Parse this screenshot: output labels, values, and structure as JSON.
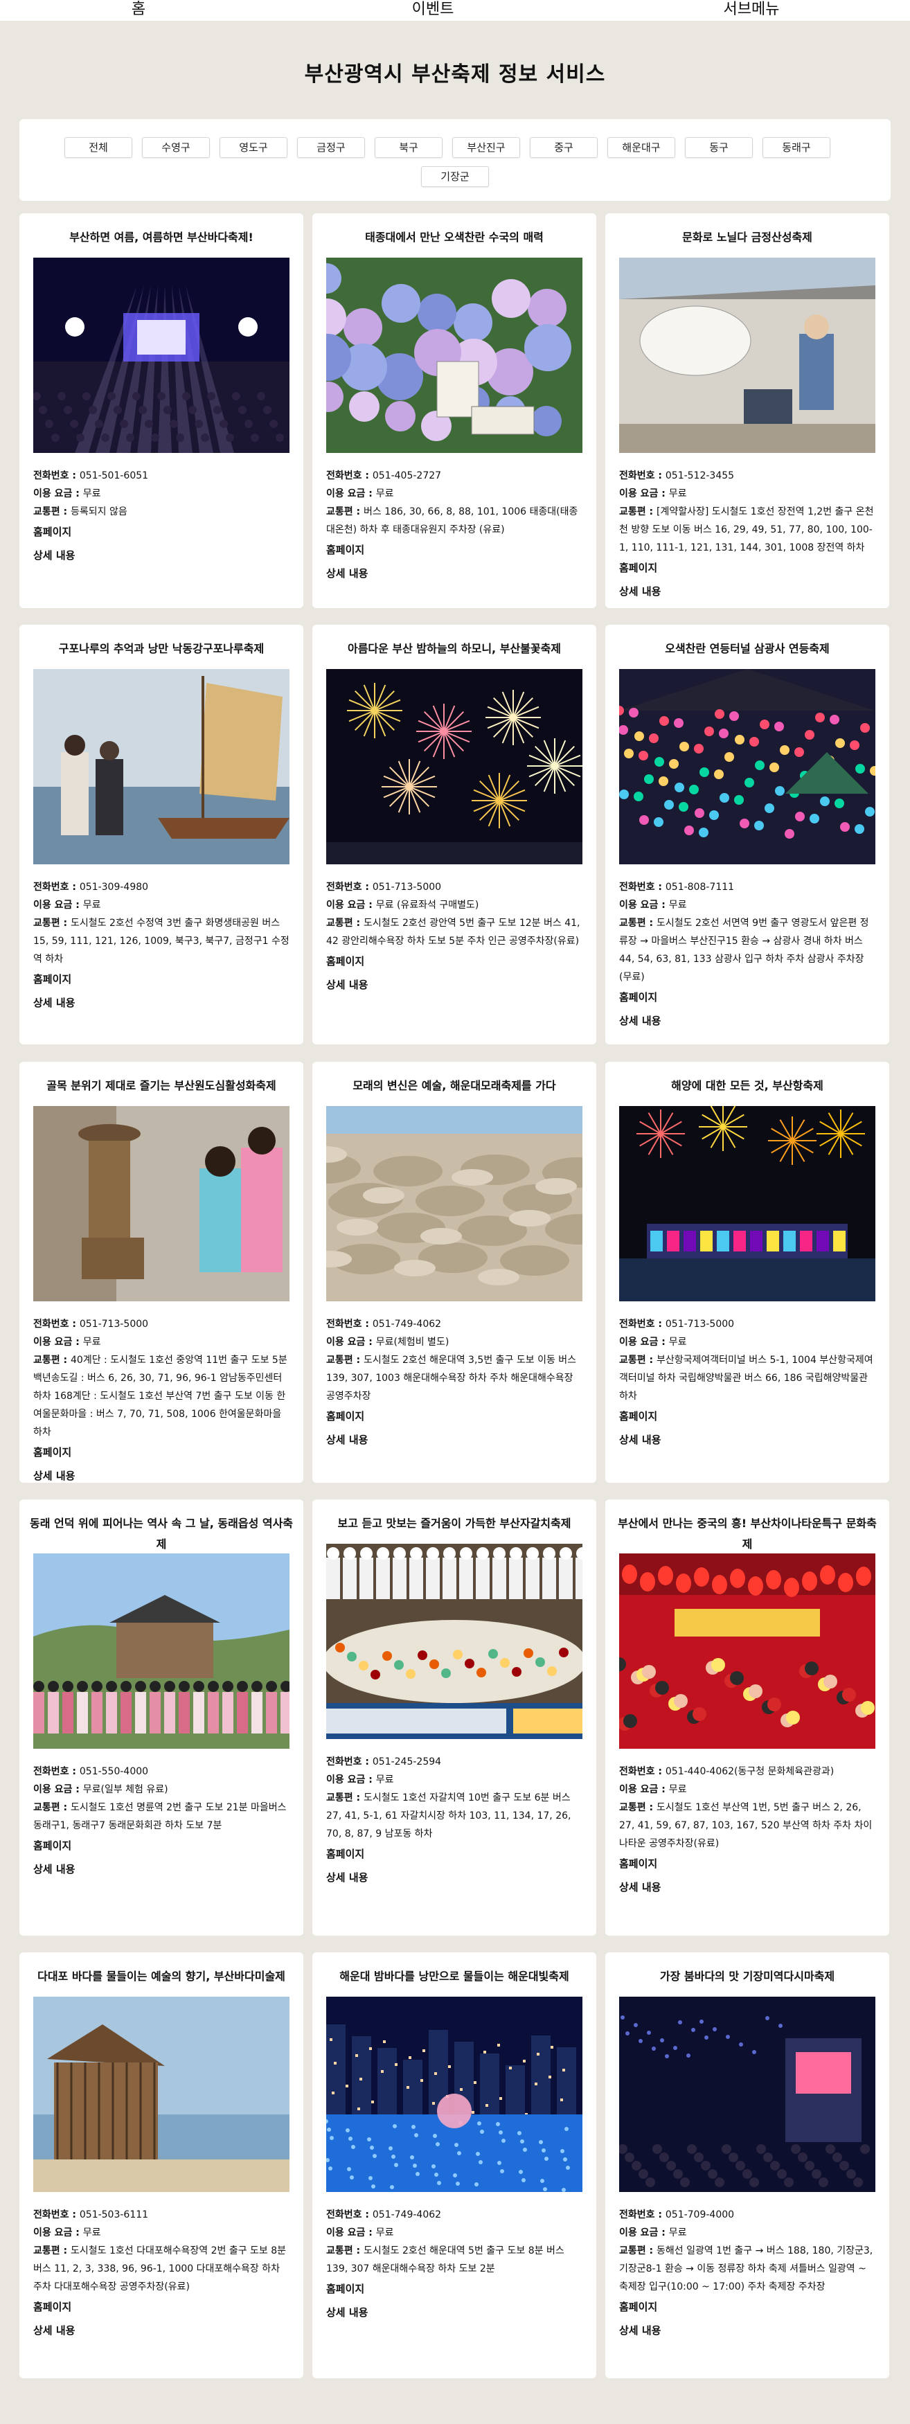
{
  "nav": {
    "home": "홈",
    "event": "이벤트",
    "submenu": "서브메뉴"
  },
  "page_title": "부산광역시 부산축제 정보 서비스",
  "filters": [
    "전체",
    "수영구",
    "영도구",
    "금정구",
    "북구",
    "부산진구",
    "중구",
    "해운대구",
    "동구",
    "동래구",
    "기장군"
  ],
  "labels": {
    "tel": "전화번호 : ",
    "fee": "이용 요금 : ",
    "traffic": "교통편 : ",
    "homepage": "홈페이지",
    "detail": "상세 내용"
  },
  "cards": [
    {
      "title": "부산하면 여름, 여름하면 부산바다축제!",
      "tel": "051-501-6051",
      "fee": "무료",
      "traffic": "등록되지 않음",
      "img": "concert-icon"
    },
    {
      "title": "태종대에서 만난 오색찬란 수국의 매력",
      "tel": "051-405-2727",
      "fee": "무료",
      "traffic": "버스 186, 30, 66, 8, 88, 101, 1006 태종대(태종대온천) 하차 후 태종대유원지 주차장 (유료)",
      "img": "hydrangea-icon"
    },
    {
      "title": "문화로 노닐다 금정산성축제",
      "tel": "051-512-3455",
      "fee": "무료",
      "traffic": "[계약할사장] 도시철도 1호선 장전역 1,2번 출구 온천천 방향 도보 이동 버스 16, 29, 49, 51, 77, 80, 100, 100-1, 110, 111-1, 121, 131, 144, 301, 1008 장전역 하차",
      "img": "fan-icon"
    },
    {
      "title": "구포나루의 추억과 낭만 낙동강구포나루축제",
      "tel": "051-309-4980",
      "fee": "무료",
      "traffic": "도시철도 2호선 수정역 3번 출구 화명생태공원 버스 15, 59, 111, 121, 126, 1009, 북구3, 북구7, 금정구1 수정역 하차",
      "img": "sailboat-icon"
    },
    {
      "title": "아름다운 부산 밤하늘의 하모니, 부산불꽃축제",
      "tel": "051-713-5000",
      "fee": "무료 (유료좌석 구매별도)",
      "traffic": "도시철도 2호선 광안역 5번 출구 도보 12분 버스 41, 42 광안리해수욕장 하차 도보 5분 주차 인근 공영주차장(유료)",
      "img": "fireworks-icon"
    },
    {
      "title": "오색찬란 연등터널 삼광사 연등축제",
      "tel": "051-808-7111",
      "fee": "무료",
      "traffic": "도시철도 2호선 서면역 9번 출구 영광도서 앞은편 정류장 → 마을버스 부산진구15 환승 → 삼광사 경내 하차 버스 44, 54, 63, 81, 133 삼광사 입구 하차 주차 삼광사 주차장(무료)",
      "img": "lantern-icon"
    },
    {
      "title": "골목 분위기 제대로 즐기는 부산원도심활성화축제",
      "tel": "051-713-5000",
      "fee": "무료",
      "traffic": "40계단 : 도시철도 1호선 중앙역 11번 출구 도보 5분 백년송도길 : 버스 6, 26, 30, 71, 96, 96-1 암남동주민센터 하차 168계단 : 도시철도 1호선 부산역 7번 출구 도보 이동 한여울문화마을 : 버스 7, 70, 71, 508, 1006 한여울문화마을 하차",
      "img": "statue-icon"
    },
    {
      "title": "모래의 변신은 예술, 해운대모래축제를 가다",
      "tel": "051-749-4062",
      "fee": "무료(체험비 별도)",
      "traffic": "도시철도 2호선 해운대역 3,5번 출구 도보 이동 버스 139, 307, 1003 해운대해수욕장 하차 주차 해운대해수욕장 공영주차장",
      "img": "sand-icon"
    },
    {
      "title": "해양에 대한 모든 것, 부산항축제",
      "tel": "051-713-5000",
      "fee": "무료",
      "traffic": "부산항국제여객터미널 버스 5-1, 1004 부산항국제여객터미널 하차 국립해양박물관 버스 66, 186 국립해양박물관 하차",
      "img": "harbor-icon"
    },
    {
      "title": "동래 언덕 위에 피어나는 역사 속 그 날, 동래읍성 역사축제",
      "tel": "051-550-4000",
      "fee": "무료(일부 체험 유료)",
      "traffic": "도시철도 1호선 명륜역 2번 출구 도보 21분 마을버스 동래구1, 동래구7 동래문화회관 하차 도보 7분",
      "img": "fortress-icon"
    },
    {
      "title": "보고 듣고 맛보는 즐거움이 가득한 부산자갈치축제",
      "tel": "051-245-2594",
      "fee": "무료",
      "traffic": "도시철도 1호선 자갈치역 10번 출구 도보 6분 버스 27, 41, 5-1, 61 자갈치시장 하차 103, 11, 134, 17, 26, 70, 8, 87, 9 남포동 하차",
      "img": "bibimbap-icon"
    },
    {
      "title": "부산에서 만나는 중국의 흥! 부산차이나타운특구 문화축제",
      "tel": "051-440-4062(동구청 문화체육관광과)",
      "fee": "무료",
      "traffic": "도시철도 1호선 부산역 1번, 5번 출구 버스 2, 26, 27, 41, 59, 67, 87, 103, 167, 520 부산역 하차 주차 차이나타운 공영주차장(유료)",
      "img": "chinatown-icon"
    },
    {
      "title": "다대포 바다를 물들이는 예술의 향기, 부산바다미술제",
      "tel": "051-503-6111",
      "fee": "무료",
      "traffic": "도시철도 1호선 다대포해수욕장역 2번 출구 도보 8분 버스 11, 2, 3, 338, 96, 96-1, 1000 다대포해수욕장 하차 주차 다대포해수욕장 공영주차장(유료)",
      "img": "seaart-icon"
    },
    {
      "title": "해운대 밤바다를 낭만으로 물들이는 해운대빛축제",
      "tel": "051-749-4062",
      "fee": "무료",
      "traffic": "도시철도 2호선 해운대역 5번 출구 도보 8분 버스 139, 307 해운대해수욕장 하차 도보 2분",
      "img": "lights-icon"
    },
    {
      "title": "가장 붐바다의 맛 기장미역다시마축제",
      "tel": "051-709-4000",
      "fee": "무료",
      "traffic": "동해선 일광역 1번 출구 → 버스 188, 180, 기장군3, 기장군8-1 환승 → 이동 정류장 하차 축제 셔틀버스 일광역 ~ 축제장 입구(10:00 ~ 17:00) 주차 축제장 주차장",
      "img": "stage-icon"
    }
  ]
}
